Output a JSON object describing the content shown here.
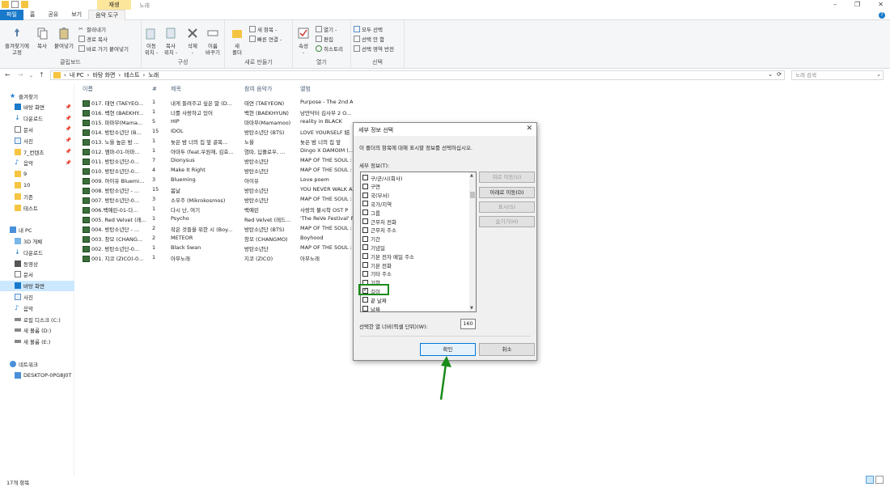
{
  "window": {
    "title": "노래",
    "context_tab": "재생"
  },
  "ribbon_tabs": [
    "파일",
    "홈",
    "공유",
    "보기",
    "음악 도구"
  ],
  "ribbon": {
    "clipboard": {
      "label": "클립보드",
      "pin": "즐겨찾기에\n고정",
      "copy": "복사",
      "paste": "붙여넣기",
      "cut": "잘라내기",
      "copy_path": "경로 복사",
      "paste_shortcut": "바로 가기 붙여넣기"
    },
    "organize": {
      "label": "구성",
      "move_to": "이동\n위치 -",
      "copy_to": "복사\n위치 -",
      "delete": "삭제\n-",
      "rename": "이름\n바꾸기"
    },
    "new": {
      "label": "새로 만들기",
      "new_folder": "새\n폴더",
      "new_item": "새 항목 -",
      "easy_access": "빠른 연결 -"
    },
    "open": {
      "label": "열기",
      "properties": "속성\n-",
      "open": "열기 -",
      "edit": "편집",
      "history": "히스토리"
    },
    "select": {
      "label": "선택",
      "select_all": "모두 선택",
      "select_none": "선택 안 함",
      "invert": "선택 영역 반전"
    }
  },
  "address": {
    "parts": [
      "내 PC",
      "바탕 화면",
      "테스트",
      "노래"
    ],
    "search_placeholder": "노래 검색"
  },
  "nav": [
    {
      "label": "즐겨찾기",
      "icon": "star-icon",
      "indent": 0,
      "pinned": false
    },
    {
      "label": "바탕 화면",
      "icon": "desktop-icon",
      "indent": 1,
      "pinned": true
    },
    {
      "label": "다운로드",
      "icon": "download-icon",
      "indent": 1,
      "pinned": true
    },
    {
      "label": "문서",
      "icon": "document-icon",
      "indent": 1,
      "pinned": true
    },
    {
      "label": "사진",
      "icon": "picture-icon",
      "indent": 1,
      "pinned": true
    },
    {
      "label": "7_컨텐츠",
      "icon": "folder-icon",
      "indent": 1,
      "pinned": true
    },
    {
      "label": "음악",
      "icon": "music-icon",
      "indent": 1,
      "pinned": true
    },
    {
      "label": "9",
      "icon": "folder-icon",
      "indent": 1,
      "pinned": false
    },
    {
      "label": "10",
      "icon": "folder-icon",
      "indent": 1,
      "pinned": false
    },
    {
      "label": "기존",
      "icon": "folder-icon",
      "indent": 1,
      "pinned": false
    },
    {
      "label": "테스트",
      "icon": "folder-icon",
      "indent": 1,
      "pinned": false
    },
    {
      "label": "",
      "icon": "",
      "indent": 0,
      "pinned": false
    },
    {
      "label": "내 PC",
      "icon": "pc-icon",
      "indent": 0,
      "pinned": false
    },
    {
      "label": "3D 개체",
      "icon": "cube-icon",
      "indent": 1,
      "pinned": false
    },
    {
      "label": "다운로드",
      "icon": "download-icon",
      "indent": 1,
      "pinned": false
    },
    {
      "label": "동영상",
      "icon": "video-icon",
      "indent": 1,
      "pinned": false
    },
    {
      "label": "문서",
      "icon": "document-icon",
      "indent": 1,
      "pinned": false
    },
    {
      "label": "바탕 화면",
      "icon": "desktop-icon",
      "indent": 1,
      "pinned": false,
      "selected": true
    },
    {
      "label": "사진",
      "icon": "picture-icon",
      "indent": 1,
      "pinned": false
    },
    {
      "label": "음악",
      "icon": "music-icon",
      "indent": 1,
      "pinned": false
    },
    {
      "label": "로컬 디스크 (C:)",
      "icon": "drive-icon",
      "indent": 1,
      "pinned": false
    },
    {
      "label": "새 볼륨 (D:)",
      "icon": "drive-icon",
      "indent": 1,
      "pinned": false
    },
    {
      "label": "새 볼륨 (E:)",
      "icon": "drive-icon",
      "indent": 1,
      "pinned": false
    },
    {
      "label": "",
      "icon": "",
      "indent": 0,
      "pinned": false
    },
    {
      "label": "네트워크",
      "icon": "network-icon",
      "indent": 0,
      "pinned": false
    },
    {
      "label": "DESKTOP-0PG8J0T",
      "icon": "pc-icon",
      "indent": 1,
      "pinned": false
    }
  ],
  "columns": [
    "이름",
    "#",
    "제목",
    "참여 음악가",
    "앨범"
  ],
  "files": [
    {
      "name": "017. 태연 (TAEYEO...",
      "num": "1",
      "title": "내게 들려주고 싶은 말 (D...",
      "artist": "태연 (TAEYEON)",
      "album": "Purpose - The 2nd A..."
    },
    {
      "name": "016. 백현 (BAEKHY...",
      "num": "1",
      "title": "너를 사랑하고 있어",
      "artist": "백현 (BAEKHYUN)",
      "album": "낭만닥터 김사부 2 O..."
    },
    {
      "name": "015. 마마무(Mama...",
      "num": "5",
      "title": "HIP",
      "artist": "마마무(Mamamoo)",
      "album": "reality in BLACK"
    },
    {
      "name": "014. 방탄소년단 (B...",
      "num": "15",
      "title": "IDOL",
      "artist": "방탄소년단 (BTS)",
      "album": "LOVE YOURSELF 結"
    },
    {
      "name": "013. 노을 높은 밤 ...",
      "num": "1",
      "title": "늦은 밤 너의 집 앞 골목...",
      "artist": "노을",
      "album": "늦은 밤 너의 집 앞"
    },
    {
      "name": "012. 엠마-01-아마...",
      "num": "1",
      "title": "아마두 (feat.우원재, 김효...",
      "artist": "염따, 딥플로우, ...",
      "album": "Dingo X DAMOIM (..."
    },
    {
      "name": "011. 방탄소년단-0...",
      "num": "7",
      "title": "Dionysus",
      "artist": "방탄소년단",
      "album": "MAP OF THE SOUL :"
    },
    {
      "name": "010. 방탄소년단-0...",
      "num": "4",
      "title": "Make It Right",
      "artist": "방탄소년단",
      "album": "MAP OF THE SOUL :"
    },
    {
      "name": "009. 아이유 Bluemi...",
      "num": "3",
      "title": "Blueming",
      "artist": "아이유",
      "album": "Love poem"
    },
    {
      "name": "008. 방탄소년단 - ...",
      "num": "15",
      "title": "봄날",
      "artist": "방탄소년단",
      "album": "YOU NEVER WALK A"
    },
    {
      "name": "007. 방탄소년단-0...",
      "num": "3",
      "title": "소우주 (Mikrokosmos)",
      "artist": "방탄소년단",
      "album": "MAP OF THE SOUL :"
    },
    {
      "name": "006.백예린-01-다...",
      "num": "1",
      "title": "다시 난, 여기",
      "artist": "백예린",
      "album": "사랑의 불시착 OST P"
    },
    {
      "name": "005. Red Velvet (레...",
      "num": "1",
      "title": "Psycho",
      "artist": "Red Velvet (레드...",
      "album": "'The ReVe Festival' Fi"
    },
    {
      "name": "004. 방탄소년단 - ...",
      "num": "2",
      "title": "작은 것들을 위한 시 (Boy...",
      "artist": "방탄소년단 (BTS)",
      "album": "MAP OF THE SOUL :"
    },
    {
      "name": "003. 창모 (CHANG...",
      "num": "2",
      "title": "METEOR",
      "artist": "창모 (CHANGMO)",
      "album": "Boyhood"
    },
    {
      "name": "002. 방탄소년단-0...",
      "num": "1",
      "title": "Black Swan",
      "artist": "방탄소년단",
      "album": "MAP OF THE SOUL :"
    },
    {
      "name": "001. 지코 (ZICO)-0...",
      "num": "1",
      "title": "아무노래",
      "artist": "지코 (ZICO)",
      "album": "아무노래"
    }
  ],
  "status": {
    "count": "17개 항목"
  },
  "dialog": {
    "title": "세부 정보 선택",
    "description": "이 폴더의 항목에 대해 표시할 정보를 선택하십시오.",
    "list_label": "세부 정보(T):",
    "items": [
      {
        "label": "구/군/시(회사)",
        "checked": false
      },
      {
        "label": "구면",
        "checked": false
      },
      {
        "label": "국(부서)",
        "checked": false
      },
      {
        "label": "국가/지역",
        "checked": false
      },
      {
        "label": "그룹",
        "checked": false
      },
      {
        "label": "근무처 전화",
        "checked": false
      },
      {
        "label": "근무처 주소",
        "checked": false
      },
      {
        "label": "기간",
        "checked": false
      },
      {
        "label": "기념일",
        "checked": false
      },
      {
        "label": "기본 전자 메일 주소",
        "checked": false
      },
      {
        "label": "기본 전화",
        "checked": false
      },
      {
        "label": "기타 주소",
        "checked": false
      },
      {
        "label": "기한",
        "checked": false
      },
      {
        "label": "길이",
        "checked": true
      },
      {
        "label": "끝 날짜",
        "checked": false
      },
      {
        "label": "날짜",
        "checked": false
      }
    ],
    "btn_up": "위로 이동(U)",
    "btn_down": "아래로 이동(D)",
    "btn_show": "표시(S)",
    "btn_hide": "숨기기(H)",
    "width_label": "선택한 열 너비(픽셀 단위)(W):",
    "width_value": "160",
    "ok": "확인",
    "cancel": "취소"
  },
  "colors": {
    "accent": "#1979ca",
    "highlight": "#1a8a1a",
    "selection": "#cce8ff"
  }
}
